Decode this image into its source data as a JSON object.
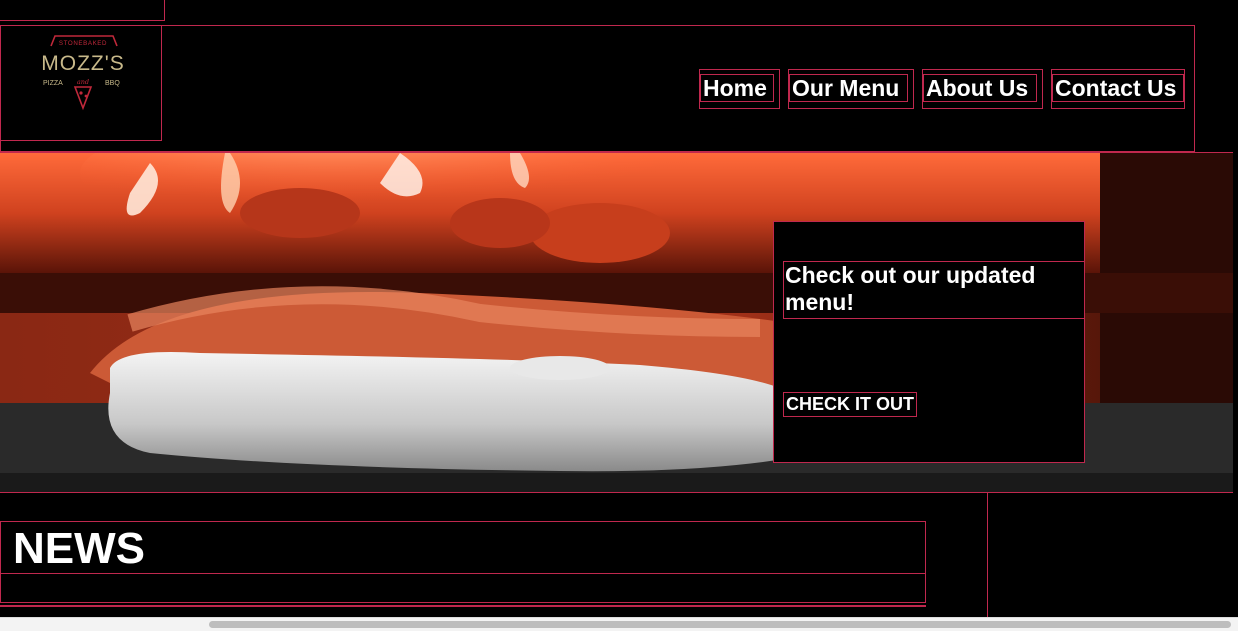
{
  "logo": {
    "top_text": "STONEBAKED",
    "name": "MOZZ'S",
    "left_text": "PIZZA",
    "middle_text": "and",
    "right_text": "BBQ",
    "colors": {
      "primary": "#c8b98a",
      "accent": "#c0283a"
    }
  },
  "nav": {
    "items": [
      {
        "label": "Home"
      },
      {
        "label": "Our Menu"
      },
      {
        "label": "About Us"
      },
      {
        "label": "Contact Us"
      }
    ]
  },
  "hero": {
    "image": "pizza-in-oven",
    "promo_title": "Check out our updated menu!",
    "promo_button": "CHECK IT OUT"
  },
  "news": {
    "heading": "NEWS"
  },
  "theme": {
    "background": "#000000",
    "text": "#ffffff",
    "outline": "#c0284e"
  }
}
